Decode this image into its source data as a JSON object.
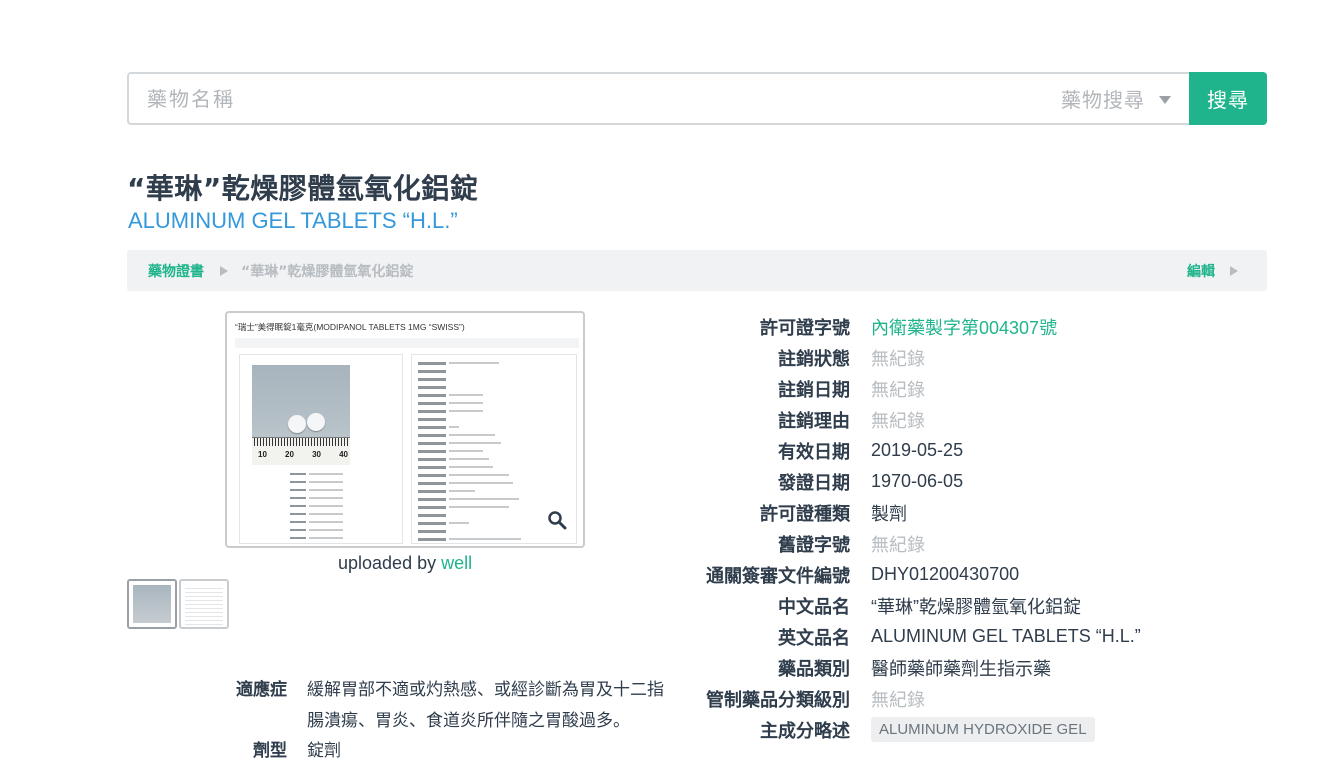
{
  "search": {
    "placeholder": "藥物名稱",
    "mode": "藥物搜尋",
    "button_label": "搜尋"
  },
  "title": {
    "zh": "“華琳”乾燥膠體氫氧化鋁錠",
    "en": "ALUMINUM GEL TABLETS “H.L.”"
  },
  "breadcrumb": {
    "root": "藥物證書",
    "current": "“華琳”乾燥膠體氫氧化鋁錠",
    "edit": "編輯"
  },
  "image": {
    "preview_title": "“瑞士”美得眠錠1毫克(MODIPANOL TABLETS 1MG “SWISS”)",
    "ruler_labels": [
      "10",
      "20",
      "30",
      "40"
    ],
    "uploaded_prefix": "uploaded by",
    "uploaded_user": "well"
  },
  "details": [
    {
      "key": "許可證字號",
      "value": "內衛藥製字第004307號",
      "style": "link"
    },
    {
      "key": "註銷狀態",
      "value": "無紀錄",
      "style": "muted"
    },
    {
      "key": "註銷日期",
      "value": "無紀錄",
      "style": "muted"
    },
    {
      "key": "註銷理由",
      "value": "無紀錄",
      "style": "muted"
    },
    {
      "key": "有效日期",
      "value": "2019-05-25",
      "style": "normal"
    },
    {
      "key": "發證日期",
      "value": "1970-06-05",
      "style": "normal"
    },
    {
      "key": "許可證種類",
      "value": "製劑",
      "style": "normal"
    },
    {
      "key": "舊證字號",
      "value": "無紀錄",
      "style": "muted"
    },
    {
      "key": "通關簽審文件編號",
      "value": "DHY01200430700",
      "style": "normal"
    },
    {
      "key": "中文品名",
      "value": "“華琳”乾燥膠體氫氧化鋁錠",
      "style": "normal"
    },
    {
      "key": "英文品名",
      "value": "ALUMINUM GEL TABLETS “H.L.”",
      "style": "normal"
    },
    {
      "key": "藥品類別",
      "value": "醫師藥師藥劑生指示藥",
      "style": "normal"
    },
    {
      "key": "管制藥品分類級別",
      "value": "無紀錄",
      "style": "muted"
    },
    {
      "key": "主成分略述",
      "value": "ALUMINUM HYDROXIDE GEL",
      "style": "tag"
    }
  ],
  "indication": {
    "key": "適應症",
    "value": "緩解胃部不適或灼熱感、或經診斷為胃及十二指腸潰瘍、胃炎、食道炎所伴隨之胃酸過多。"
  },
  "dosage_form": {
    "key": "劑型",
    "value": "錠劑"
  },
  "colors": {
    "accent": "#1fb48c",
    "link_blue": "#3498db",
    "muted": "#b8bdc2",
    "text": "#2f3d4c"
  }
}
